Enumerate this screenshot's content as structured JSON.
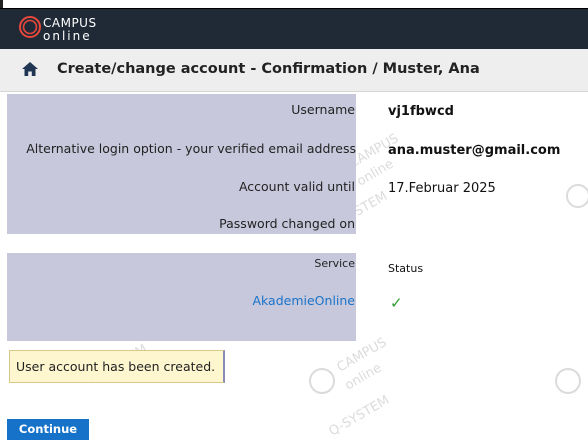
{
  "brand": {
    "line1": "CAMPUS",
    "line2": "online"
  },
  "header": {
    "title": "Create/change account - Confirmation / Muster, Ana"
  },
  "account": {
    "rows": [
      {
        "label": "Username",
        "value": "vj1fbwcd"
      },
      {
        "label": "Alternative login option - your verified email address",
        "value": "ana.muster@gmail.com"
      },
      {
        "label": "Account valid until",
        "value": "17.Februar 2025"
      },
      {
        "label": "Password changed on",
        "value": ""
      }
    ]
  },
  "services": {
    "service_header": "Service",
    "status_header": "Status",
    "items": [
      {
        "name": "AkademieOnline",
        "status": "✓"
      }
    ]
  },
  "watermark": {
    "line1": "CAMPUS",
    "line2": "online",
    "line3": "Q-SYSTEM"
  },
  "notice": {
    "text": "User account has been created."
  },
  "actions": {
    "continue_label": "Continue"
  },
  "colors": {
    "accent": "#1672c9",
    "check": "#2a9d2a",
    "appbar": "#1f2a36"
  }
}
